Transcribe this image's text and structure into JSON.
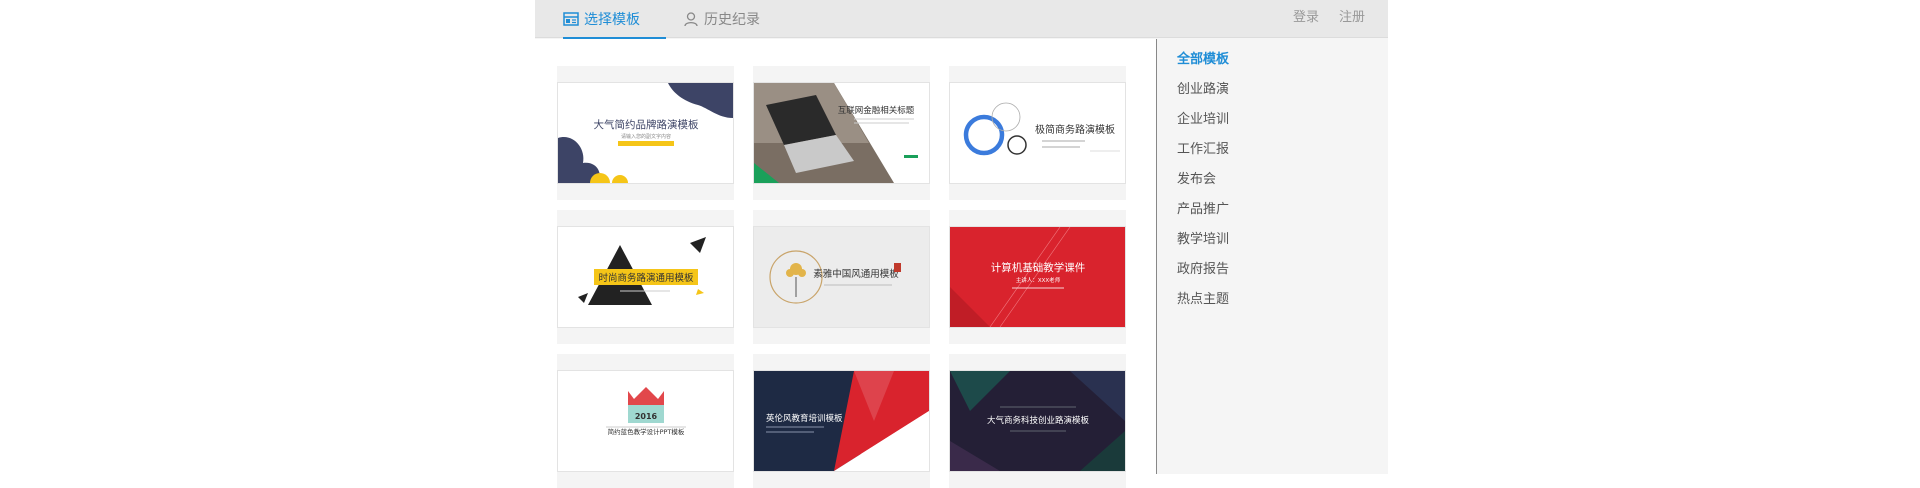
{
  "tabs": {
    "templates": "选择模板",
    "history": "历史纪录"
  },
  "auth": {
    "login": "登录",
    "register": "注册"
  },
  "categories": [
    "全部模板",
    "创业路演",
    "企业培训",
    "工作汇报",
    "发布会",
    "产品推广",
    "教学培训",
    "政府报告",
    "热点主题"
  ],
  "active_category": "全部模板",
  "templates": [
    {
      "title": "大气简约品牌路演模板",
      "subtitle": "请输入您的副文字内容"
    },
    {
      "title": "互联网金融相关标题",
      "subtitle": ""
    },
    {
      "title": "极简商务路演模板",
      "subtitle": ""
    },
    {
      "title": "时尚商务路演通用模板",
      "subtitle": ""
    },
    {
      "title": "素雅中国风通用模板",
      "subtitle": ""
    },
    {
      "title": "计算机基础教学课件",
      "subtitle": "主讲人：XXX老师"
    },
    {
      "title": "2016",
      "subtitle": "简约蓝色教学设计PPT模板"
    },
    {
      "title": "英伦风教育培训模板",
      "subtitle": ""
    },
    {
      "title": "大气商务科技创业路演模板",
      "subtitle": ""
    }
  ],
  "colors": {
    "accent": "#1f8dd6",
    "navy": "#3d4466",
    "yellow": "#f5c518",
    "red": "#d9232d",
    "dark_navy": "#1e2a44",
    "teal": "#9fd8d0"
  }
}
